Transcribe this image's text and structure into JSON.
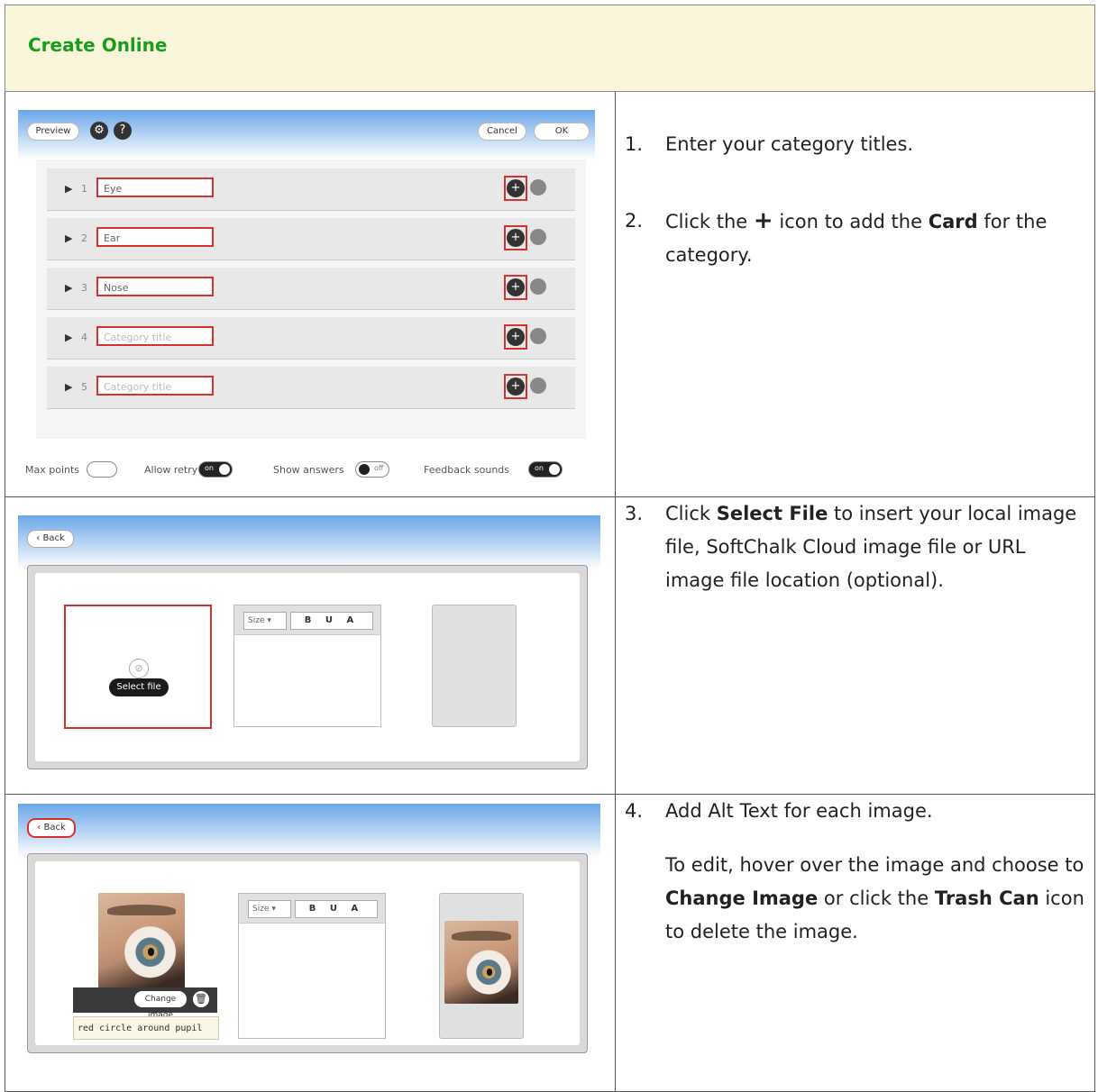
{
  "header": {
    "title": "Create Online"
  },
  "shot1": {
    "preview_label": "Preview",
    "gear_icon": "gear-icon",
    "help_icon": "?",
    "cancel_label": "Cancel",
    "ok_label": "OK",
    "categories": [
      {
        "num": "1",
        "value": "Eye",
        "placeholder": false
      },
      {
        "num": "2",
        "value": "Ear",
        "placeholder": false
      },
      {
        "num": "3",
        "value": "Nose",
        "placeholder": false
      },
      {
        "num": "4",
        "value": "Category title",
        "placeholder": true
      },
      {
        "num": "5",
        "value": "Category title",
        "placeholder": true
      }
    ],
    "max_points": "Max points",
    "allow_retry": "Allow retry",
    "show_answers": "Show answers",
    "feedback_sounds": "Feedback sounds",
    "on": "on",
    "off": "off"
  },
  "steps": {
    "s1": {
      "num": "1.",
      "text": "Enter your category titles."
    },
    "s2": {
      "num": "2.",
      "pre": "Click the",
      "icon": "+",
      "mid": "icon to add the",
      "bold": "Card",
      "post": "for the category."
    },
    "s3": {
      "num": "3.",
      "pre": "Click",
      "bold": "Select File",
      "post": "to insert your local image file, SoftChalk Cloud image file or URL image file location (optional)."
    },
    "s4": {
      "num": "4.",
      "text": "Add Alt Text for each image.",
      "p2_a": "To edit, hover over the image and choose to",
      "p2_b": "Change Image",
      "p2_c": "or click the",
      "p2_d": "Trash Can",
      "p2_e": "icon to delete the image."
    }
  },
  "shot2": {
    "back_label": "Back",
    "size_label": "Size",
    "format_label": "B U A",
    "select_file_label": "Select file"
  },
  "shot3": {
    "back_label": "Back",
    "size_label": "Size",
    "format_label": "B U A",
    "change_image_label": "Change image",
    "alt_text": "red circle around pupil"
  }
}
